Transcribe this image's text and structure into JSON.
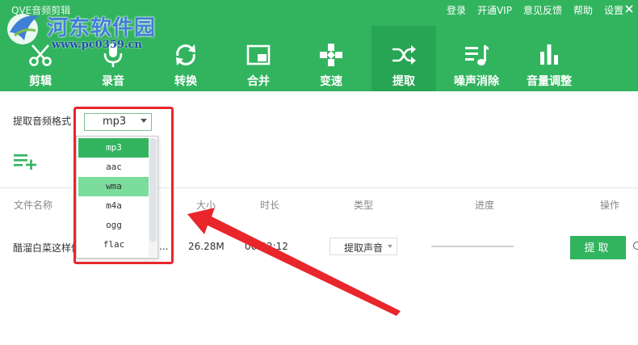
{
  "app": {
    "title": "QVE音频剪辑"
  },
  "watermark": {
    "site": "河东软件园",
    "url": "www.pc0359.cn"
  },
  "top_links": [
    "登录",
    "开通VIP",
    "意见反馈",
    "帮助",
    "设置"
  ],
  "toolbar": {
    "items": [
      {
        "label": "剪辑",
        "icon": "scissors-icon"
      },
      {
        "label": "录音",
        "icon": "microphone-icon"
      },
      {
        "label": "转换",
        "icon": "convert-arrows-icon"
      },
      {
        "label": "合并",
        "icon": "merge-window-icon"
      },
      {
        "label": "变速",
        "icon": "gamepad-speed-icon"
      },
      {
        "label": "提取",
        "icon": "shuffle-extract-icon",
        "active": true
      },
      {
        "label": "噪声消除",
        "icon": "music-list-icon"
      },
      {
        "label": "音量调整",
        "icon": "volume-bars-icon"
      }
    ]
  },
  "format": {
    "label": "提取音频格式",
    "value": "mp3",
    "options": [
      "mp3",
      "aac",
      "wma",
      "m4a",
      "ogg",
      "flac"
    ],
    "selected": "mp3",
    "hovered": "wma"
  },
  "table": {
    "headers": [
      "文件名称",
      "大小",
      "时长",
      "类型",
      "进度",
      "操作"
    ],
    "rows": [
      {
        "name": "醋溜白菜这样做",
        "name_suffix": "...",
        "size": "26.28M",
        "duration": "00:02:12",
        "type": "提取声音",
        "progress": 0,
        "action": "提取"
      }
    ]
  },
  "colors": {
    "brand": "#32b45f",
    "brand_dark": "#28a455",
    "hover": "#7bdc9c",
    "annotation": "#e8262b"
  }
}
